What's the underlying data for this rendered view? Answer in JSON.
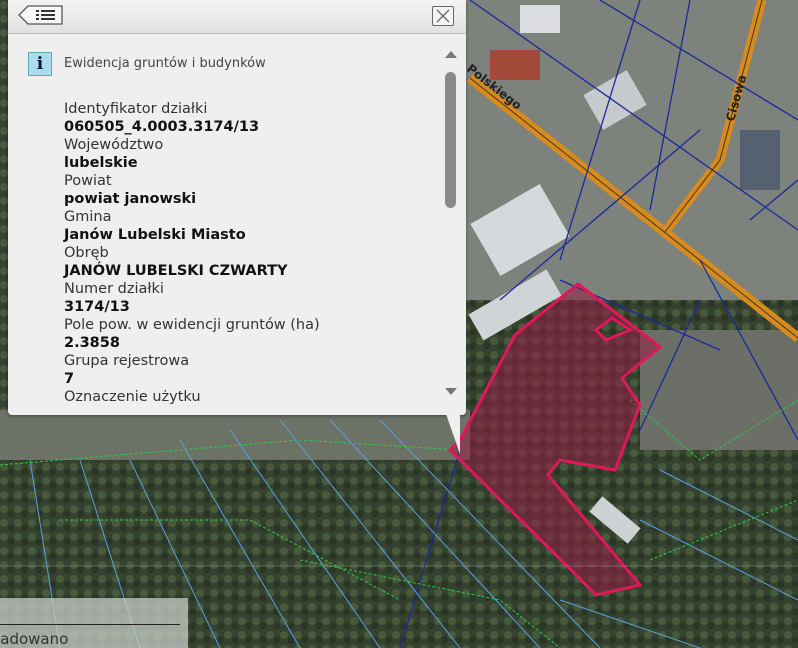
{
  "panel": {
    "back_icon": "list-back-icon",
    "close_icon": "close-icon",
    "source_icon": "info-icon",
    "source_icon_text": "i",
    "source": "Ewidencja gruntów i budynków",
    "fields": [
      {
        "label": "Identyfikator działki",
        "value": "060505_4.0003.3174/13"
      },
      {
        "label": "Województwo",
        "value": "lubelskie"
      },
      {
        "label": "Powiat",
        "value": "powiat janowski"
      },
      {
        "label": "Gmina",
        "value": "Janów Lubelski Miasto"
      },
      {
        "label": "Obręb",
        "value": "JANÓW LUBELSKI CZWARTY"
      },
      {
        "label": "Numer działki",
        "value": "3174/13"
      },
      {
        "label": "Pole pow. w ewidencji gruntów (ha)",
        "value": "2.3858"
      },
      {
        "label": "Grupa rejestrowa",
        "value": "7"
      },
      {
        "label": "Oznaczenie użytku",
        "value": ""
      }
    ]
  },
  "map": {
    "street_1": "Polskiego",
    "street_2": "Cisowa",
    "parcel_color": "#e0185a",
    "road_color": "#d98a1c"
  },
  "status": {
    "text": "ładowano"
  }
}
